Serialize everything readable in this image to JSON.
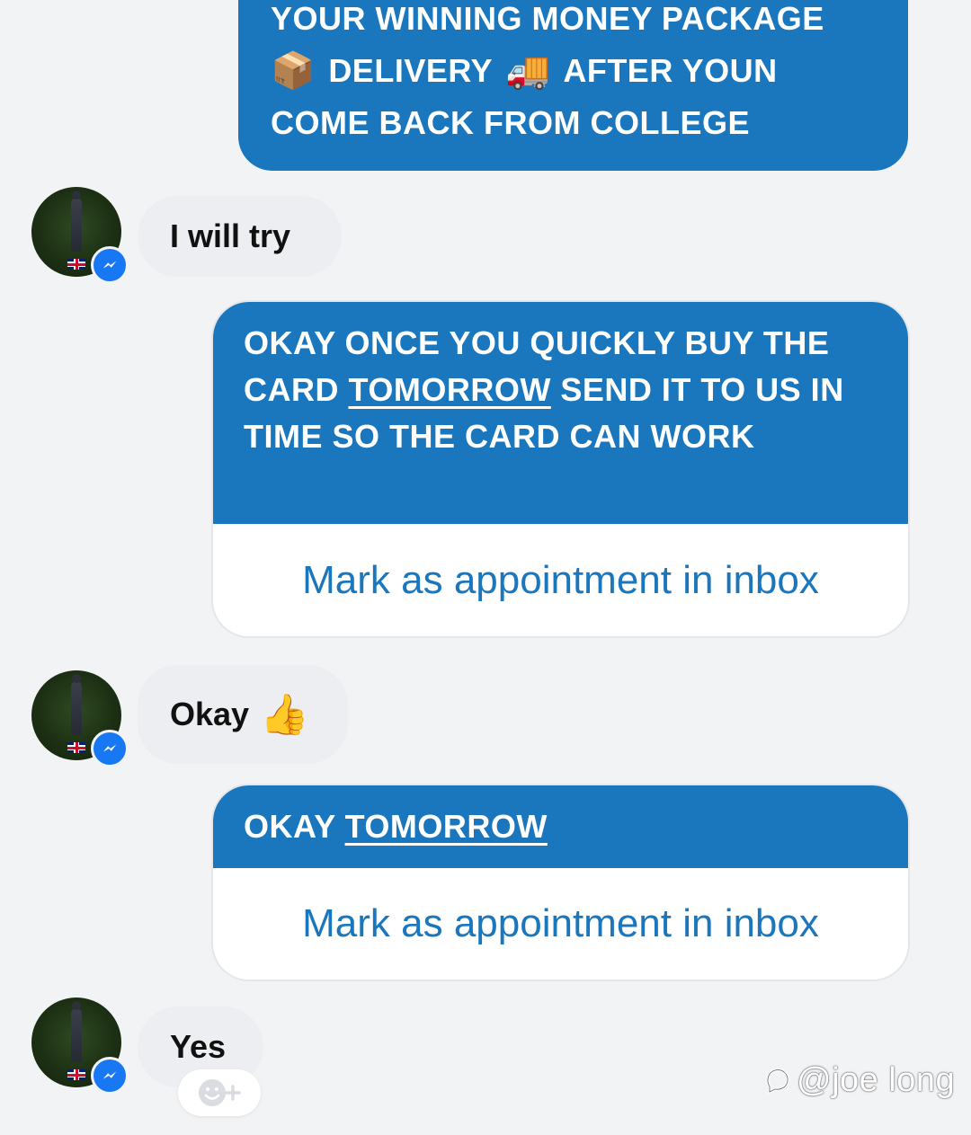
{
  "messages": {
    "m1": {
      "line1": "YOUR WINNING MONEY PACKAGE",
      "line2_emoji1": "📦",
      "line2_a": "DELIVERY",
      "line2_emoji2": "🚚",
      "line2_b": "AFTER YOUN",
      "line3": "COME BACK FROM COLLEGE"
    },
    "m2": {
      "text": "I will try"
    },
    "m3": {
      "part1": "OKAY ONCE YOU QUICKLY BUY THE CARD ",
      "link": "TOMORROW",
      "part2": " SEND IT TO US IN TIME SO THE CARD CAN WORK",
      "action": "Mark as appointment in inbox"
    },
    "m4": {
      "text": "Okay",
      "emoji": "👍"
    },
    "m5": {
      "part1": "OKAY ",
      "link": "TOMORROW",
      "action": "Mark as appointment in inbox"
    },
    "m6": {
      "text": "Yes"
    }
  },
  "icons": {
    "avatar": "profile-photo",
    "badge": "messenger-icon",
    "flag": "uk-flag-icon",
    "reaction": "add-reaction-icon"
  },
  "watermark": {
    "text": "@joe long"
  },
  "colors": {
    "outgoing": "#1b77bd",
    "incoming": "#eceef1",
    "background": "#f2f3f5",
    "action_text": "#1b77bd",
    "messenger_badge": "#1877f2"
  }
}
